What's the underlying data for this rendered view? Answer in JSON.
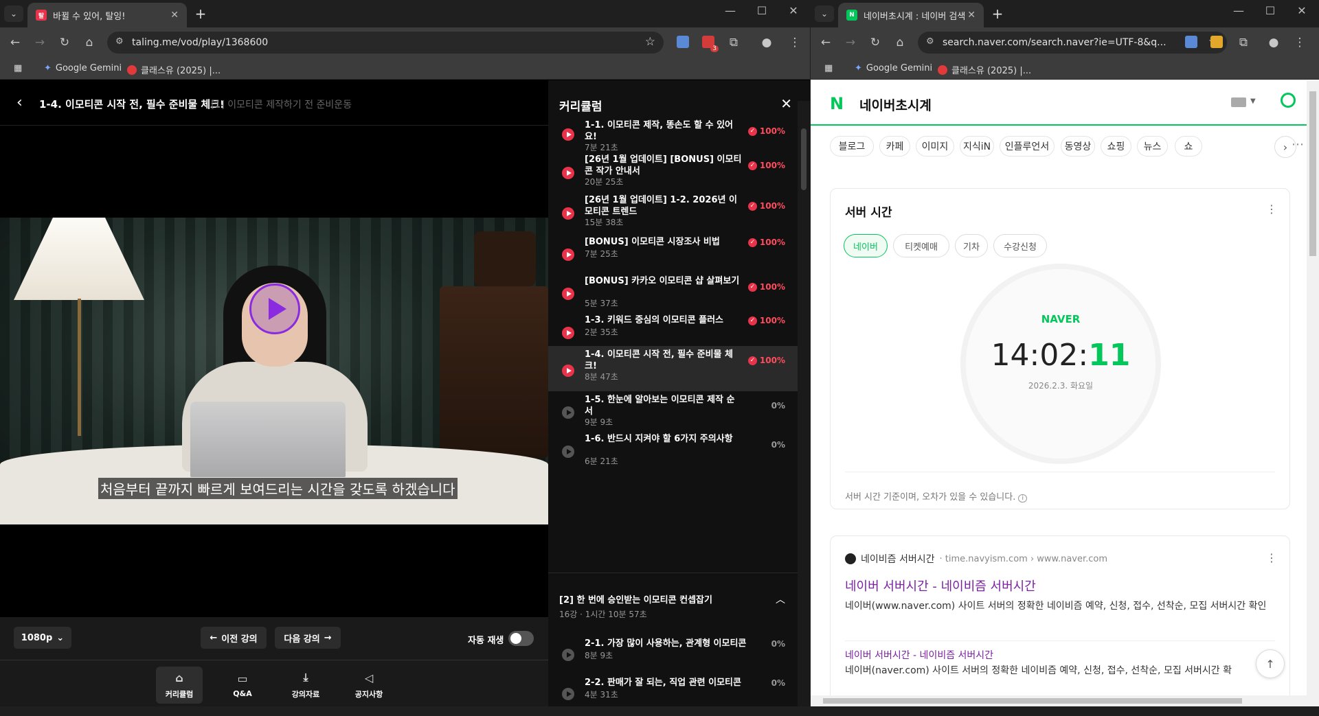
{
  "left_window": {
    "tab": {
      "title": "바뀔 수 있어, 탈잉!",
      "favicon": "탈"
    },
    "url": "taling.me/vod/play/1368600",
    "bookmarks": [
      {
        "label": "Google Gemini"
      },
      {
        "label": "클래스유 (2025) |..."
      }
    ],
    "ext_badge": "3",
    "header": {
      "title": "1-4. 이모티콘 시작 전, 필수 준비물 체크!",
      "subtitle": "[1] 이모티콘 제작하기 전 준비운동"
    },
    "subtitle_text": "처음부터 끝까지 빠르게 보여드리는 시간을 갖도록 하겠습니다",
    "controls": {
      "quality": "1080p",
      "prev": "이전 강의",
      "next": "다음 강의",
      "autoplay": "자동 재생"
    },
    "bottom_nav": [
      {
        "label": "커리큘럼",
        "icon": "cap-icon"
      },
      {
        "label": "Q&A",
        "icon": "chat-icon"
      },
      {
        "label": "강의자료",
        "icon": "download-icon"
      },
      {
        "label": "공지사항",
        "icon": "megaphone-icon"
      }
    ],
    "curriculum": {
      "title": "커리큘럼",
      "items": [
        {
          "title": "1-1. 이모티콘 제작, 똥손도 할 수 있어요!",
          "duration": "7분 21초",
          "progress": "100%"
        },
        {
          "title": "[26년 1월 업데이트] [BONUS] 이모티콘 작가 안내서",
          "duration": "20분 25초",
          "progress": "100%"
        },
        {
          "title": "[26년 1월 업데이트] 1-2. 2026년 이모티콘 트렌드",
          "duration": "15분 38초",
          "progress": "100%"
        },
        {
          "title": "[BONUS] 이모티콘 시장조사 비법",
          "duration": "7분 25초",
          "progress": "100%"
        },
        {
          "title": "[BONUS] 카카오 이모티콘 샵 살펴보기",
          "duration": "5분 37초",
          "progress": "100%"
        },
        {
          "title": "1-3. 키워드 중심의 이모티콘 플러스",
          "duration": "2분 35초",
          "progress": "100%"
        },
        {
          "title": "1-4. 이모티콘 시작 전, 필수 준비물 체크!",
          "duration": "8분 47초",
          "progress": "100%"
        },
        {
          "title": "1-5. 한눈에 알아보는 이모티콘 제작 순서",
          "duration": "9분 9초",
          "progress": "0%"
        },
        {
          "title": "1-6. 반드시 지켜야 할 6가지 주의사항",
          "duration": "6분 21초",
          "progress": "0%"
        }
      ],
      "section2": {
        "title": "[2] 한 번에 승인받는 이모티콘 컨셉잡기",
        "meta": "16강 · 1시간 10분 57초"
      },
      "items2": [
        {
          "title": "2-1. 가장 많이 사용하는, 관계형 이모티콘",
          "duration": "8분 9초",
          "progress": "0%"
        },
        {
          "title": "2-2. 판매가 잘 되는, 직업 관련 이모티콘",
          "duration": "4분 31초",
          "progress": "0%"
        }
      ]
    }
  },
  "right_window": {
    "tab": {
      "title": "네이버초시계 : 네이버 검색",
      "favicon": "N"
    },
    "url": "search.naver.com/search.naver?ie=UTF-8&q...",
    "bookmarks": [
      {
        "label": "Google Gemini"
      },
      {
        "label": "클래스유 (2025) |..."
      }
    ],
    "query": "네이버초시계",
    "tabs": [
      "블로그",
      "카페",
      "이미지",
      "지식iN",
      "인플루언서",
      "동영상",
      "쇼핑",
      "뉴스",
      "쇼"
    ],
    "server_time": {
      "title": "서버 시간",
      "chips": [
        "네이버",
        "티켓예매",
        "기차",
        "수강신청"
      ],
      "brand": "NAVER",
      "hm": "14:02:",
      "sec": "11",
      "date": "2026.2.3. 화요일",
      "note": "서버 시간 기준이며, 오차가 있을 수 있습니다."
    },
    "result": {
      "source_name": "네이비즘 서버시간",
      "source_url": "time.navyism.com › www.naver.com",
      "title": "네이버 서버시간 - 네이비즘 서버시간",
      "desc": "네이버(www.naver.com) 사이트 서버의 정확한 네이비즘 예약, 신청, 접수, 선착순, 모집 서버시간 확인",
      "sub_title": "네이버 서버시간 - 네이비즘 서버시간",
      "sub_desc": "네이버(naver.com) 사이트 서버의 정확한 네이비즘 예약, 신청, 접수, 선착순, 모집 서버시간 확"
    }
  },
  "colors": {
    "naver_green": "#03c75a",
    "taling_red": "#e8334a",
    "link_purple": "#7a1fa2"
  }
}
